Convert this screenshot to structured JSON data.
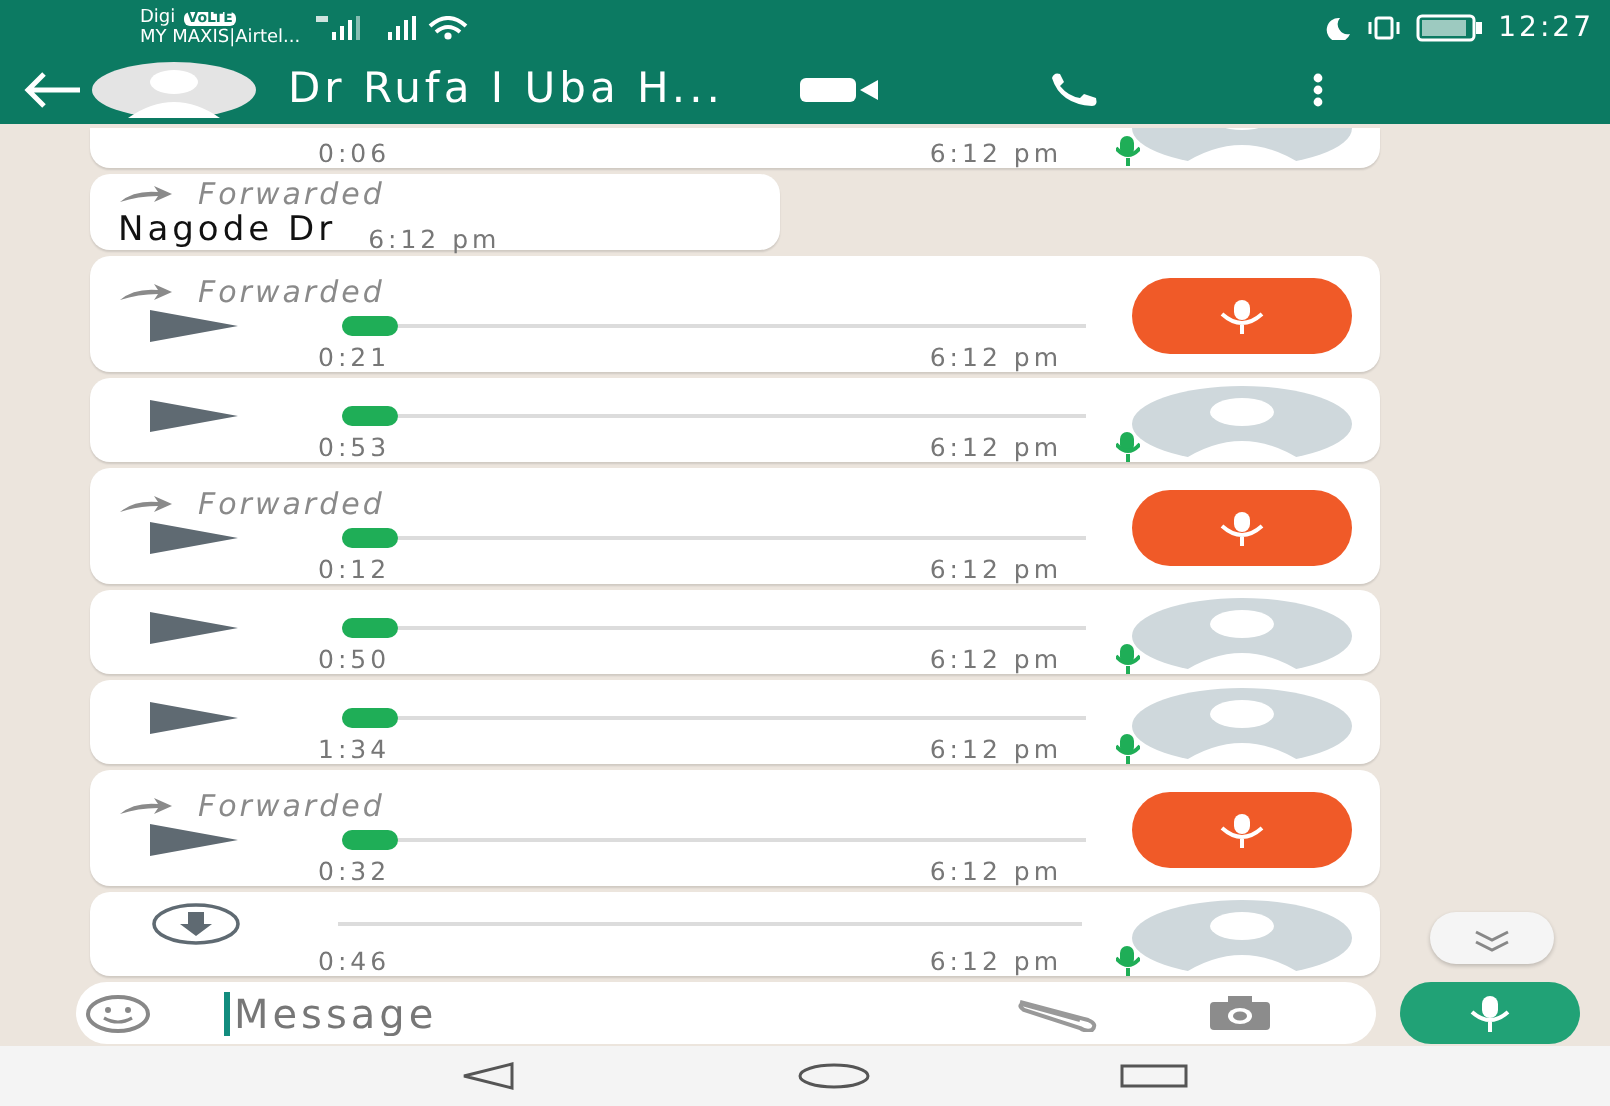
{
  "status_bar": {
    "carrier": "Digi",
    "network_badge": "VoLTE",
    "carrier_2": "MY MAXIS|Airtel...",
    "time": "12:27"
  },
  "header": {
    "title": "Dr Rufa I Uba H..."
  },
  "messages": [
    {
      "kind": "voice",
      "duration": "0:06",
      "time": "6:12 pm",
      "avatar": {
        "kind": "contact"
      }
    },
    {
      "kind": "text",
      "forwarded": true,
      "forwarded_label": "Forwarded",
      "text": "Nagode Dr",
      "time": "6:12 pm"
    },
    {
      "kind": "voice",
      "forwarded": true,
      "forwarded_label": "Forwarded",
      "control": {
        "kind": "play",
        "level": 0
      },
      "duration": "0:21",
      "time": "6:12 pm",
      "avatar": {
        "kind": "sender"
      }
    },
    {
      "kind": "voice",
      "control": {
        "kind": "play",
        "level": 0
      },
      "duration": "0:53",
      "time": "6:12 pm",
      "avatar": {
        "kind": "contact"
      }
    },
    {
      "kind": "voice",
      "forwarded": true,
      "forwarded_label": "Forwarded",
      "control": {
        "kind": "play",
        "level": 0
      },
      "duration": "0:12",
      "time": "6:12 pm",
      "avatar": {
        "kind": "sender"
      }
    },
    {
      "kind": "voice",
      "control": {
        "kind": "play",
        "level": 0
      },
      "duration": "0:50",
      "time": "6:12 pm",
      "avatar": {
        "kind": "contact"
      }
    },
    {
      "kind": "voice",
      "control": {
        "kind": "play",
        "level": 0
      },
      "duration": "1:34",
      "time": "6:12 pm",
      "avatar": {
        "kind": "contact"
      }
    },
    {
      "kind": "voice",
      "forwarded": true,
      "forwarded_label": "Forwarded",
      "control": {
        "kind": "play",
        "level": 0
      },
      "duration": "0:32",
      "time": "6:12 pm",
      "avatar": {
        "kind": "sender"
      }
    },
    {
      "kind": "voice",
      "control": {
        "kind": "download"
      },
      "duration": "0:46",
      "time": "6:12 pm",
      "avatar": {
        "kind": "contact"
      }
    }
  ],
  "composer": {
    "placeholder": "Message"
  }
}
